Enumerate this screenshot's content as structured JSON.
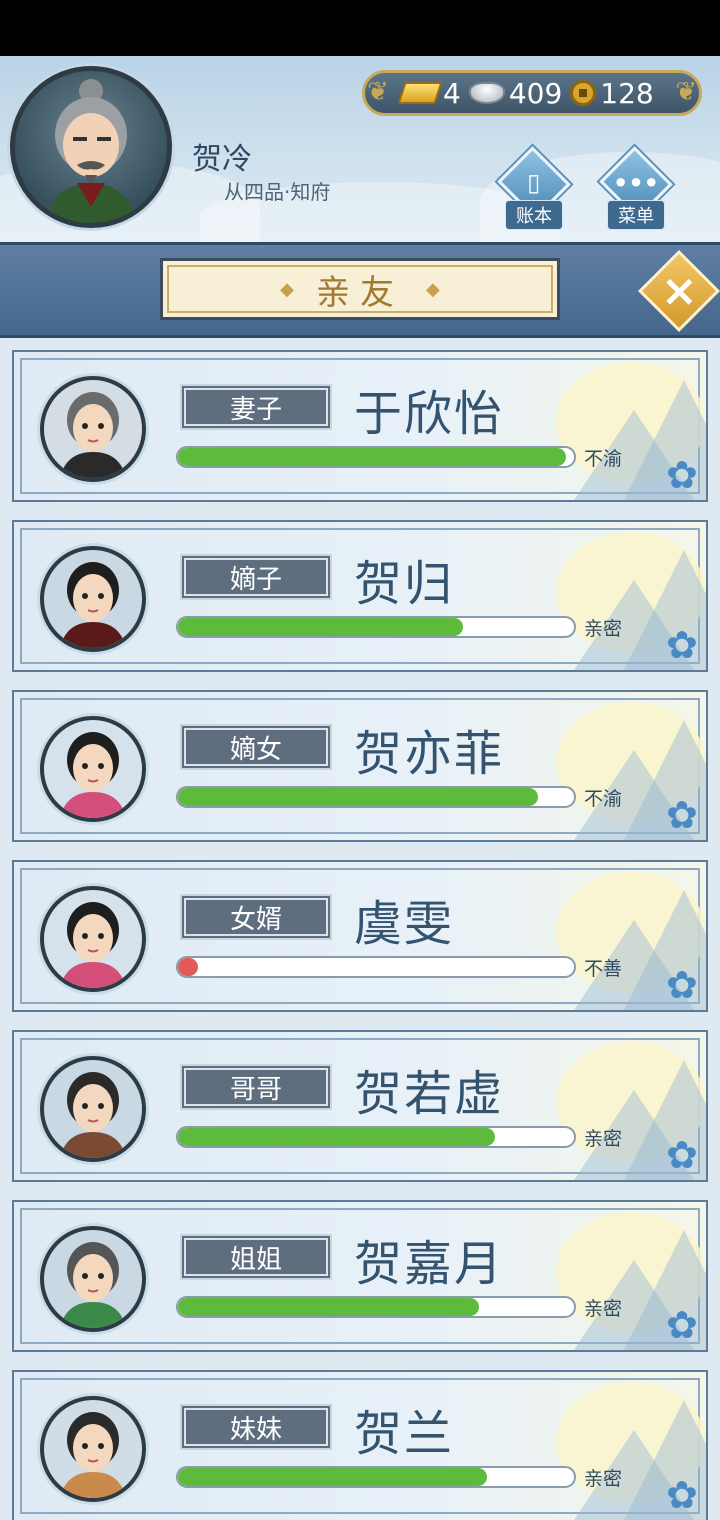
{
  "player": {
    "name": "贺冷",
    "rank": "从四品·知府"
  },
  "currency": {
    "gold": "4",
    "silver": "409",
    "coins": "128"
  },
  "header_buttons": {
    "ledger": "账本",
    "menu": "菜单"
  },
  "page_title": "亲友",
  "colors": {
    "bar_green": "#5dbb3c",
    "bar_red": "#e25a5a"
  },
  "relatives": [
    {
      "relation": "妻子",
      "name": "于欣怡",
      "affection": 0.98,
      "mood": "不渝",
      "bar_color": "#5dbb3c"
    },
    {
      "relation": "嫡子",
      "name": "贺归",
      "affection": 0.72,
      "mood": "亲密",
      "bar_color": "#5dbb3c"
    },
    {
      "relation": "嫡女",
      "name": "贺亦菲",
      "affection": 0.91,
      "mood": "不渝",
      "bar_color": "#5dbb3c"
    },
    {
      "relation": "女婿",
      "name": "虞雯",
      "affection": 0.05,
      "mood": "不善",
      "bar_color": "#e25a5a"
    },
    {
      "relation": "哥哥",
      "name": "贺若虚",
      "affection": 0.8,
      "mood": "亲密",
      "bar_color": "#5dbb3c"
    },
    {
      "relation": "姐姐",
      "name": "贺嘉月",
      "affection": 0.76,
      "mood": "亲密",
      "bar_color": "#5dbb3c"
    },
    {
      "relation": "妹妹",
      "name": "贺兰",
      "affection": 0.78,
      "mood": "亲密",
      "bar_color": "#5dbb3c"
    }
  ]
}
